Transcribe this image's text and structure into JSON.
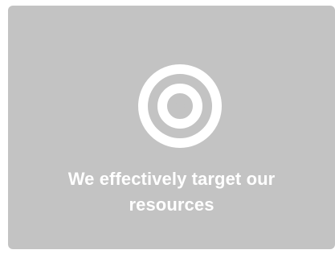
{
  "card": {
    "icon": "target-icon",
    "caption": "We effectively target our resources",
    "background_color": "#c3c3c3",
    "text_color": "#ffffff"
  }
}
